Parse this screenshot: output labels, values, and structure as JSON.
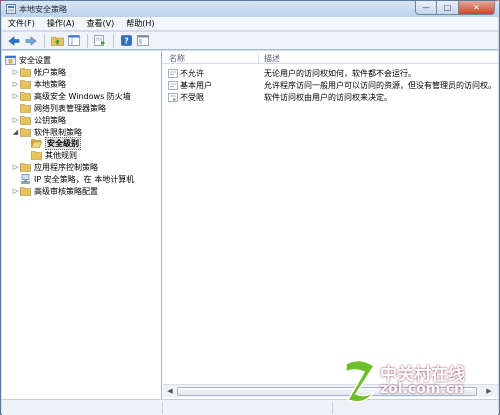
{
  "window": {
    "title": "本地安全策略",
    "buttons": {
      "minimize": "—",
      "maximize": "□",
      "close": "✕"
    }
  },
  "menu": [
    {
      "label": "文件(F)"
    },
    {
      "label": "操作(A)"
    },
    {
      "label": "查看(V)"
    },
    {
      "label": "帮助(H)"
    }
  ],
  "toolbar": {
    "icons": [
      "back-arrow-icon",
      "forward-arrow-icon",
      "up-folder-icon",
      "show-hide-tree-icon",
      "export-list-icon",
      "help-icon",
      "properties-icon"
    ]
  },
  "tree": [
    {
      "label": "安全设置",
      "depth": 0,
      "expander": "none",
      "icon": "security-settings-icon"
    },
    {
      "label": "帐户策略",
      "depth": 1,
      "expander": "collapsed",
      "icon": "folder-icon"
    },
    {
      "label": "本地策略",
      "depth": 1,
      "expander": "collapsed",
      "icon": "folder-icon"
    },
    {
      "label": "高级安全 Windows 防火墙",
      "depth": 1,
      "expander": "collapsed",
      "icon": "folder-icon"
    },
    {
      "label": "网络列表管理器策略",
      "depth": 1,
      "expander": "none",
      "icon": "folder-icon"
    },
    {
      "label": "公钥策略",
      "depth": 1,
      "expander": "collapsed",
      "icon": "folder-icon"
    },
    {
      "label": "软件限制策略",
      "depth": 1,
      "expander": "expanded",
      "icon": "folder-icon"
    },
    {
      "label": "安全级别",
      "depth": 2,
      "expander": "none",
      "icon": "open-folder-icon",
      "selected": true
    },
    {
      "label": "其他规则",
      "depth": 2,
      "expander": "none",
      "icon": "folder-icon"
    },
    {
      "label": "应用程序控制策略",
      "depth": 1,
      "expander": "collapsed",
      "icon": "folder-icon"
    },
    {
      "label": "IP 安全策略，在 本地计算机",
      "depth": 1,
      "expander": "none",
      "icon": "ip-security-icon"
    },
    {
      "label": "高级审核策略配置",
      "depth": 1,
      "expander": "collapsed",
      "icon": "folder-icon"
    }
  ],
  "list": {
    "columns": [
      "名称",
      "描述"
    ],
    "rows": [
      {
        "name": "不允许",
        "description": "无论用户的访问权如何，软件都不会运行。"
      },
      {
        "name": "基本用户",
        "description": "允许程序访问一般用户可以访问的资源，但没有管理员的访问权。"
      },
      {
        "name": "不受限",
        "description": "软件访问权由用户的访问权来决定。"
      }
    ]
  },
  "watermark": {
    "line1": "中关村在线",
    "line2": "zol.com.cn"
  },
  "colors": {
    "folder": "#e8c25c",
    "accent": "#3a78c9"
  }
}
